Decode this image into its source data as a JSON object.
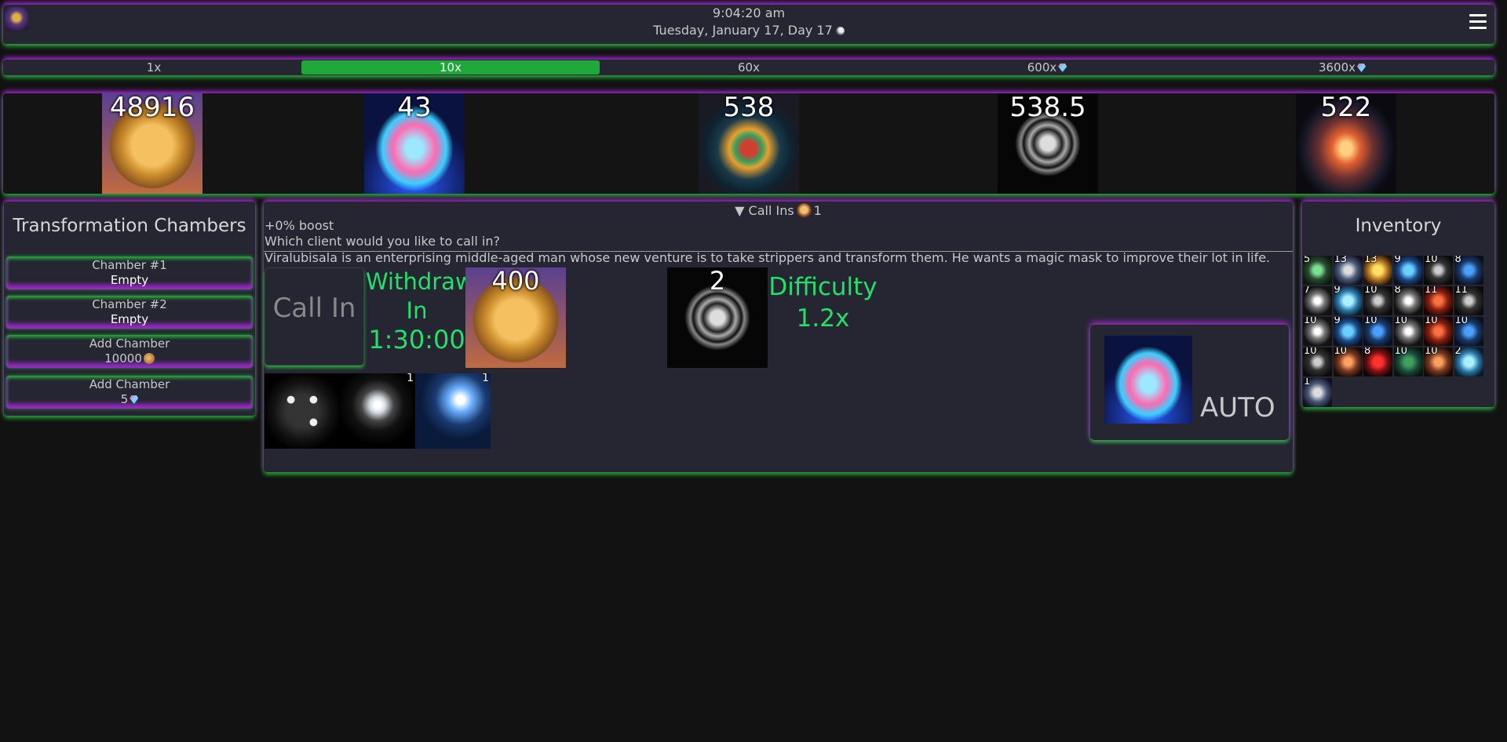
{
  "header": {
    "time": "9:04:20 am",
    "date": "Tuesday, January 17, Day 17"
  },
  "speeds": [
    {
      "label": "1x",
      "active": false,
      "gem": false
    },
    {
      "label": "10x",
      "active": true,
      "gem": false
    },
    {
      "label": "60x",
      "active": false,
      "gem": false
    },
    {
      "label": "600x",
      "active": false,
      "gem": true
    },
    {
      "label": "3600x",
      "active": false,
      "gem": true
    }
  ],
  "resources": [
    {
      "name": "gold-coin",
      "value": "48916"
    },
    {
      "name": "diamond",
      "value": "43"
    },
    {
      "name": "medallion",
      "value": "538"
    },
    {
      "name": "demon-mask",
      "value": "538.5"
    },
    {
      "name": "fire-egg",
      "value": "522"
    }
  ],
  "chambers": {
    "title": "Transformation Chambers",
    "items": [
      {
        "line1": "Chamber #1",
        "line2": "Empty"
      },
      {
        "line1": "Chamber #2",
        "line2": "Empty"
      },
      {
        "line1": "Add Chamber",
        "line2": "10000"
      },
      {
        "line1": "Add Chamber",
        "line2": "5"
      }
    ]
  },
  "callins": {
    "toggle_label": "▼ Call Ins",
    "count": "1",
    "boost": "+0% boost",
    "question": "Which client would you like to call in?",
    "description": "Viralubisala is an enterprising middle-aged man whose new venture is to take strippers and transform them. He wants a magic mask to improve their lot in life.",
    "call_in_label": "Call In",
    "withdraw_label": "Withdraw In",
    "withdraw_time": "1:30:00",
    "reward_value": "400",
    "mask_count": "2",
    "difficulty_label": "Difficulty",
    "difficulty_value": "1.2x",
    "modifiers": [
      {
        "name": "dice",
        "count": ""
      },
      {
        "name": "snowflake-monitor",
        "count": "1"
      },
      {
        "name": "magic-monitor",
        "count": "1"
      }
    ],
    "auto_label": "AUTO"
  },
  "inventory": {
    "title": "Inventory",
    "items": [
      "5",
      "13",
      "13",
      "9",
      "10",
      "8",
      "7",
      "9",
      "10",
      "8",
      "11",
      "11",
      "10",
      "9",
      "10",
      "10",
      "10",
      "10",
      "10",
      "10",
      "8",
      "10",
      "10",
      "2",
      "1"
    ]
  }
}
